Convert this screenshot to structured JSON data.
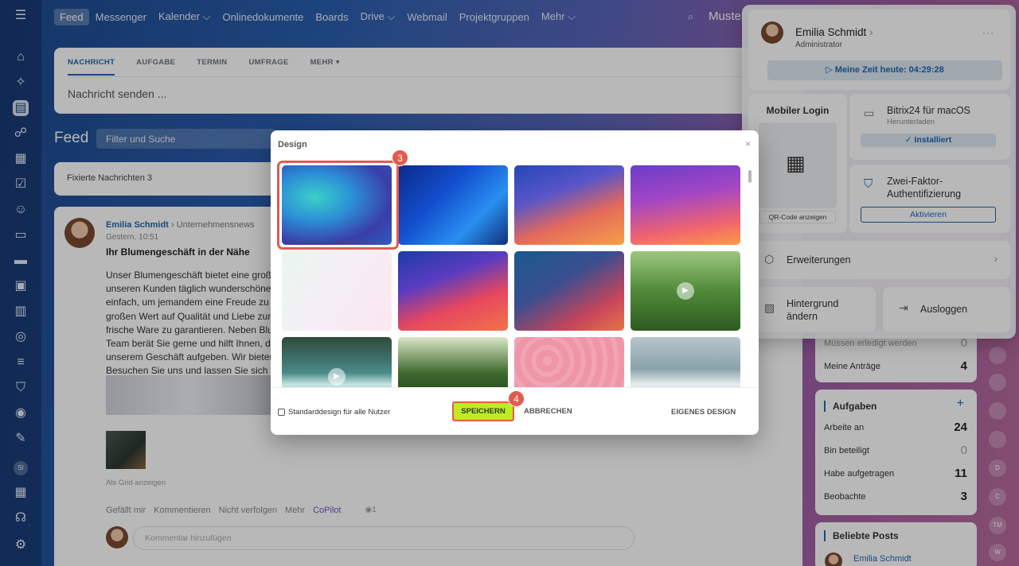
{
  "nav": {
    "tabs": [
      "Feed",
      "Messenger",
      "Kalender ⌵",
      "Onlinedokumente",
      "Boards",
      "Drive ⌵",
      "Webmail",
      "Projektgruppen",
      "Mehr ⌵"
    ],
    "search_text": "Muster"
  },
  "composer": {
    "tabs": [
      "NACHRICHT",
      "AUFGABE",
      "TERMIN",
      "UMFRAGE",
      "MEHR ▾"
    ],
    "placeholder": "Nachricht senden ..."
  },
  "feed": {
    "title": "Feed",
    "filter_placeholder": "Filter und Suche",
    "pinned": "Fixierte Nachrichten 3"
  },
  "post": {
    "author": "Emilia Schmidt",
    "destination": "› Unternehmensnews",
    "date": "Gestern, 10:51",
    "heading": "Ihr Blumengeschäft in der Nähe",
    "body_lines": [
      "Unser Blumengeschäft bietet eine große",
      "unseren Kunden täglich wunderschöne S",
      "einfach, um jemandem eine Freude zu m",
      "großen Wert auf Qualität und Liebe zum",
      "frische Ware zu garantieren. Neben Blun",
      "Team berät Sie gerne und hilft Ihnen, das",
      "unserem Geschäft aufgeben. Wir bieten",
      "Besuchen Sie uns und lassen Sie sich vo"
    ],
    "grid_link": "Als Grid anzeigen",
    "actions": [
      "Gefällt mir",
      "Kommentieren",
      "Nicht verfolgen",
      "Mehr"
    ],
    "copilot": "CoPilot",
    "views": "◉1",
    "comment_placeholder": "Kommentar hinzufügen"
  },
  "widgets": {
    "antraege": [
      {
        "label": "Müssen erledigt werden",
        "value": "0"
      },
      {
        "label": "Meine Anträge",
        "value": "4"
      }
    ],
    "aufgaben": {
      "title": "Aufgaben",
      "add": "+",
      "rows": [
        {
          "label": "Arbeite an",
          "value": "24"
        },
        {
          "label": "Bin beteiligt",
          "value": "0"
        },
        {
          "label": "Habe aufgetragen",
          "value": "11"
        },
        {
          "label": "Beobachte",
          "value": "3"
        }
      ]
    },
    "posts": {
      "title": "Beliebte Posts",
      "first_author": "Emilia Schmidt"
    }
  },
  "right_strip": [
    "",
    "",
    "",
    "",
    "D",
    "C",
    "TM",
    "W"
  ],
  "profile": {
    "name": "Emilia Schmidt",
    "name_arrow": "›",
    "role": "Administrator",
    "more": "···",
    "time": "▷ Meine Zeit heute: 04:29:28",
    "mobile_login": "Mobiler Login",
    "qr_label": "QR-Code anzeigen",
    "app_title": "Bitrix24 für macOS",
    "app_sub": "Herunterladen",
    "installed": "✓ Installiert",
    "twofa_line1": "Zwei-Faktor-",
    "twofa_line2": "Authentifizierung",
    "activate": "Aktivieren",
    "extensions": "Erweiterungen",
    "background_line1": "Hintergrund",
    "background_line2": "ändern",
    "logout": "Ausloggen"
  },
  "modal": {
    "title": "Design",
    "close": "×",
    "default_design": "Standarddesign für alle Nutzer",
    "save": "SPEICHERN",
    "cancel": "ABBRECHEN",
    "own_design": "EIGENES DESIGN",
    "badge_select": "3",
    "badge_save": "4",
    "tiles": [
      {
        "name": "blue-teal-waves",
        "bg": "radial-gradient(ellipse at 30% 40%, #3bd0c8 0%, #2b8fd6 35%, #3b3da8 70%, #2b5cc4 100%)"
      },
      {
        "name": "deep-blue-curves",
        "bg": "linear-gradient(135deg, #0b2a8a 0%, #1450d0 40%, #2a8ff0 70%, #10307a 100%)"
      },
      {
        "name": "blue-orange-flow",
        "bg": "linear-gradient(160deg, #2448b8 0%, #5a55c8 35%, #e46a5a 65%, #f3a04a 100%)"
      },
      {
        "name": "purple-orange",
        "bg": "linear-gradient(170deg, #6b3cc8 0%, #a447c4 40%, #f0646e 75%, #fb9b4a 100%)"
      },
      {
        "name": "pastel-triangle",
        "bg": "linear-gradient(120deg, #e8f7ee 0%, #f6eef6 50%, #fbe7ef 100%)"
      },
      {
        "name": "blue-red-waves",
        "bg": "linear-gradient(160deg, #1b3ca6 0%, #5a3cc0 35%, #e6475e 65%, #f2734a 100%)"
      },
      {
        "name": "teal-red-gradient",
        "bg": "linear-gradient(150deg, #1a5a8c 0%, #3a4e90 40%, #c8455a 75%, #e8744a 100%)"
      },
      {
        "name": "meadow-video",
        "bg": "linear-gradient(180deg, #9cc77e 0%, #4f8a3a 50%, #2f5a20 100%)"
      },
      {
        "name": "waterfall-video",
        "bg": "linear-gradient(180deg, #2f4a3a 0%, #4a8a8a 45%, #c8e6e0 60%, #1a6a6a 100%)"
      },
      {
        "name": "forest-lake",
        "bg": "linear-gradient(180deg, #d8e6c8 0%, #3f6a2e 45%, #2a4a20 70%, #8aa878 100%)"
      },
      {
        "name": "pink-hearts",
        "bg": "repeating-radial-gradient(circle at 30% 30%, #f2a3b4 0 6px, #ef95a8 6px 14px)"
      },
      {
        "name": "ocean-waves",
        "bg": "linear-gradient(180deg, #b8c6cc 0%, #8aa2aa 40%, #e8eef0 60%, #5c7a84 100%)"
      }
    ]
  }
}
